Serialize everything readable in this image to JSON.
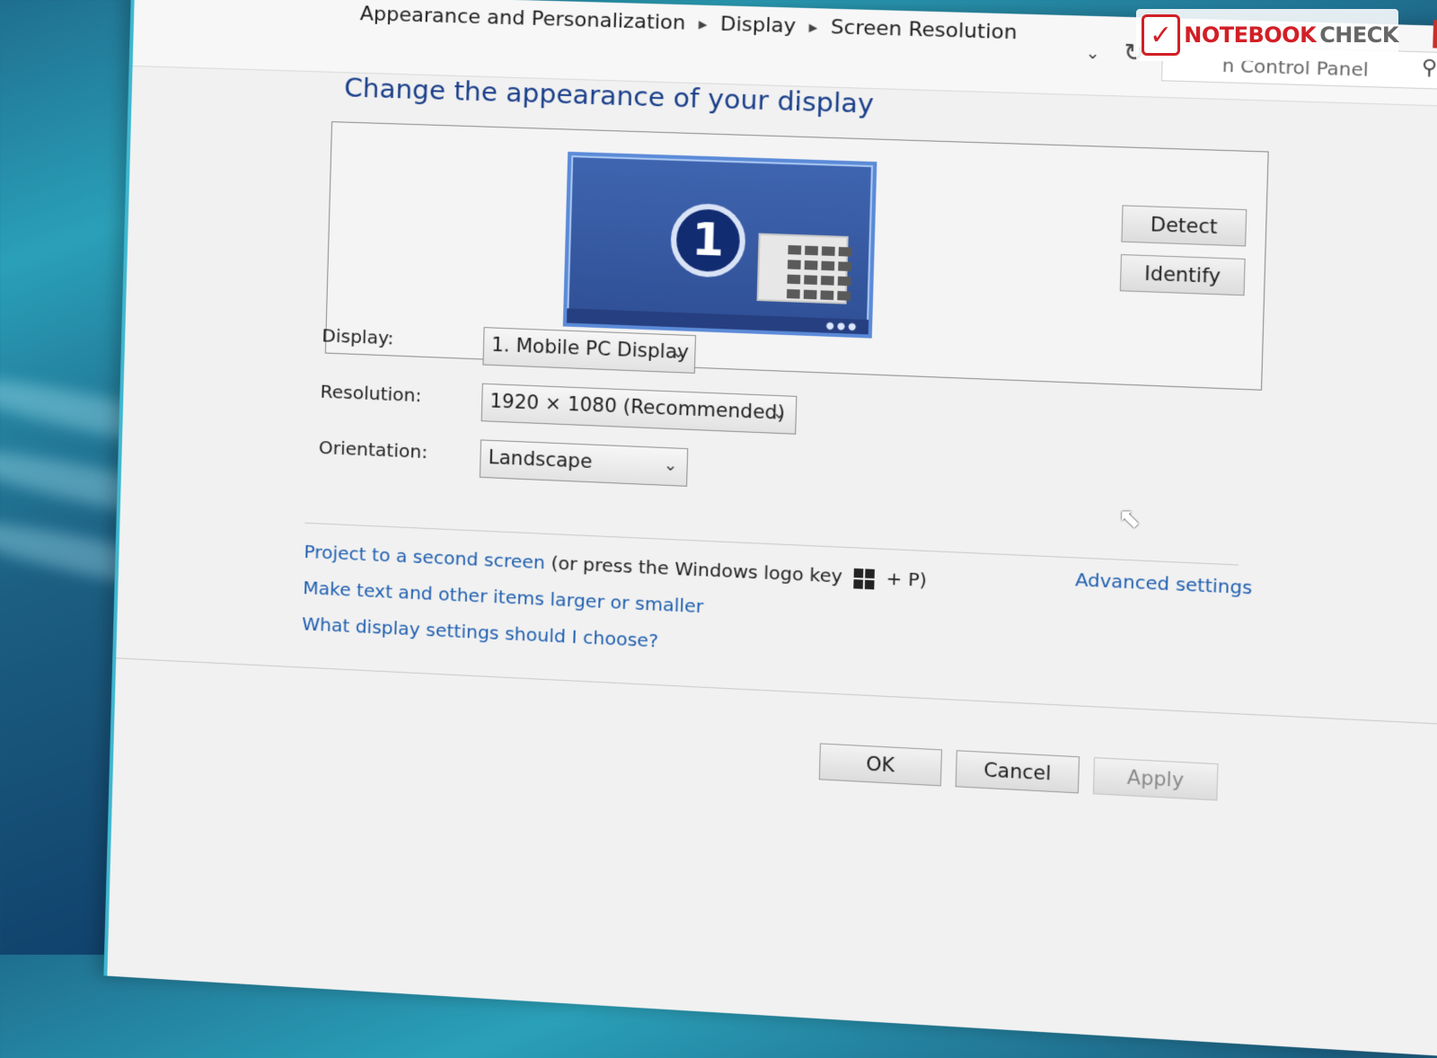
{
  "breadcrumb": {
    "items": [
      "Appearance and Personalization",
      "Display",
      "Screen Resolution"
    ]
  },
  "search": {
    "text": "n Control Panel"
  },
  "page": {
    "title": "Change the appearance of your display"
  },
  "monitor": {
    "number": "1"
  },
  "buttons": {
    "detect": "Detect",
    "identify": "Identify",
    "ok": "OK",
    "cancel": "Cancel",
    "apply": "Apply"
  },
  "form": {
    "display_label": "Display:",
    "display_value": "1. Mobile PC Display",
    "resolution_label": "Resolution:",
    "resolution_value": "1920 × 1080 (Recommended)",
    "orientation_label": "Orientation:",
    "orientation_value": "Landscape"
  },
  "links": {
    "advanced": "Advanced settings",
    "project": "Project to a second screen",
    "project_hint_pre": "(or press the Windows logo key",
    "project_hint_post": "+ P)",
    "text_size": "Make text and other items larger or smaller",
    "help": "What display settings should I choose?"
  },
  "watermark": {
    "brand_red": "NOTEBOOK",
    "brand_grey": "CHECK"
  },
  "icons": {
    "refresh": "refresh-icon",
    "search": "search-icon",
    "chevron": "chevron-down-icon",
    "windows": "windows-logo-icon",
    "cursor": "mouse-cursor-icon"
  },
  "colors": {
    "link": "#1f5fb0",
    "title": "#1a3f8a",
    "accent": "#3fb7cf"
  }
}
